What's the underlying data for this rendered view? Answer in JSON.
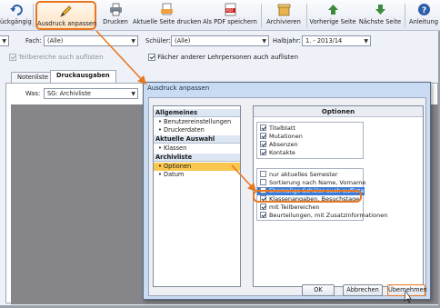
{
  "toolbar": {
    "buttons": [
      {
        "label": "ückgängig",
        "icon": "undo-icon"
      },
      {
        "label": "Ausdruck anpassen",
        "icon": "pencil-icon"
      },
      {
        "label": "Drucken",
        "icon": "printer-icon"
      },
      {
        "label": "Aktuelle Seite drucken",
        "icon": "print-page-icon"
      },
      {
        "label": "Als PDF speichern",
        "icon": "pdf-icon"
      },
      {
        "label": "Archivieren",
        "icon": "archive-icon"
      },
      {
        "label": "Vorherige Seite",
        "icon": "arrow-up-icon"
      },
      {
        "label": "Nächste Seite",
        "icon": "arrow-down-icon"
      },
      {
        "label": "Anleitung",
        "icon": "help-icon"
      }
    ]
  },
  "filters": {
    "fach_label": "Fach:",
    "fach_value": "(Alle)",
    "schueler_label": "Schüler:",
    "schueler_value": "(Alle)",
    "halbjahr_label": "Halbjahr:",
    "halbjahr_value": "1. - 2013/14"
  },
  "options": {
    "teilbereiche": "Teilbereiche auch auflisten",
    "faecher": "Fächer anderer Lehrpersonen auch auflisten"
  },
  "tabs": [
    "Notenliste",
    "Druckausgaben"
  ],
  "was": {
    "label": "Was:",
    "value": "SG: Archivliste"
  },
  "dialog": {
    "title": "Ausdruck anpassen",
    "nav": [
      {
        "type": "header",
        "label": "Allgemeines"
      },
      {
        "type": "item",
        "label": "• Benutzereinstellungen"
      },
      {
        "type": "item",
        "label": "• Druckerdaten"
      },
      {
        "type": "header",
        "label": "Aktuelle Auswahl"
      },
      {
        "type": "item",
        "label": "• Klassen"
      },
      {
        "type": "header",
        "label": "Archivliste"
      },
      {
        "type": "item",
        "label": "• Optionen",
        "selected": true
      },
      {
        "type": "item",
        "label": "• Datum"
      }
    ],
    "options_title": "Optionen",
    "group1": [
      {
        "label": "Titelblatt",
        "checked": true
      },
      {
        "label": "Mutationen",
        "checked": true
      },
      {
        "label": "Absenzen",
        "checked": true
      },
      {
        "label": "Kontakte",
        "checked": true
      }
    ],
    "group2": [
      {
        "label": "nur aktuelles Semester",
        "checked": false
      },
      {
        "label": "Sortierung nach Name, Vorname",
        "checked": false
      },
      {
        "label": "Ehemalige Schüler auch auflisten",
        "checked": false,
        "selected": true
      },
      {
        "label": "Klassenangaben, Besuchstage",
        "checked": true
      },
      {
        "label": "mit Teilbereichen",
        "checked": true
      },
      {
        "label": "Beurteilungen, mit Zusatzinformationen",
        "checked": true
      }
    ],
    "ok_label": "OK",
    "cancel_label": "Abbrechen",
    "apply_label": "Übernehmen"
  },
  "colors": {
    "highlight": "#e87722",
    "selection": "#3a7bd5",
    "nav_selected": "#f9c74f"
  }
}
